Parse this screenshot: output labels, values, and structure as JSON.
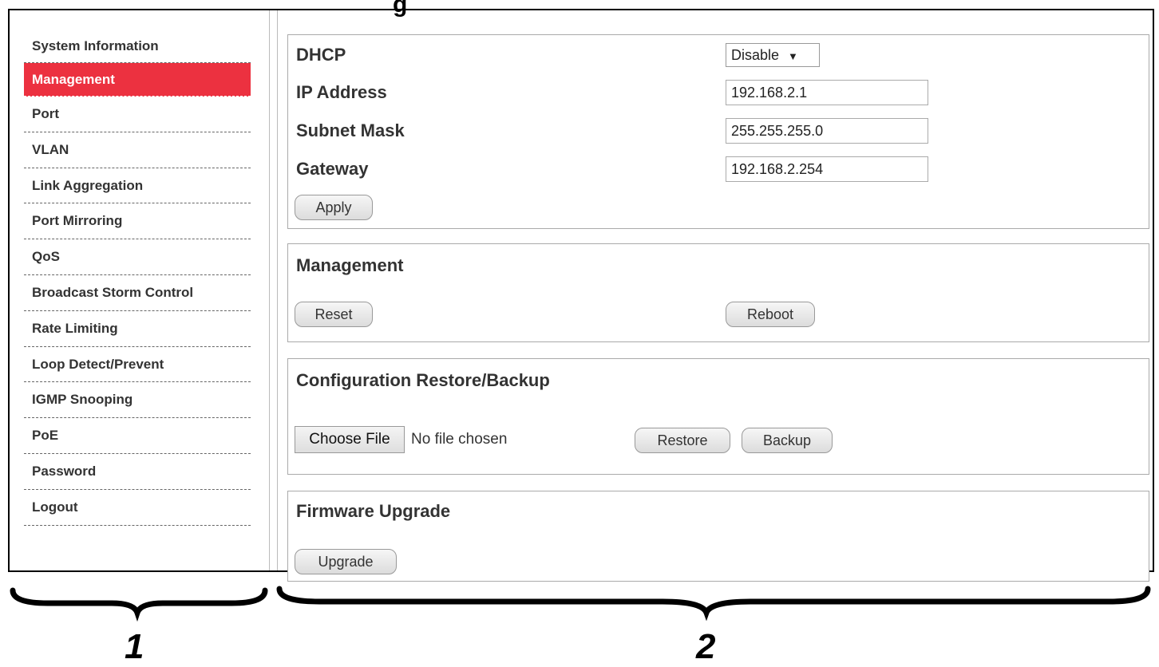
{
  "page_title_partial": "g",
  "sidebar": {
    "items": [
      {
        "label": "System Information",
        "active": false
      },
      {
        "label": "Management",
        "active": true
      },
      {
        "label": "Port",
        "active": false
      },
      {
        "label": "VLAN",
        "active": false
      },
      {
        "label": "Link Aggregation",
        "active": false
      },
      {
        "label": "Port Mirroring",
        "active": false
      },
      {
        "label": "QoS",
        "active": false
      },
      {
        "label": "Broadcast Storm Control",
        "active": false
      },
      {
        "label": "Rate Limiting",
        "active": false
      },
      {
        "label": "Loop Detect/Prevent",
        "active": false
      },
      {
        "label": "IGMP Snooping",
        "active": false
      },
      {
        "label": "PoE",
        "active": false
      },
      {
        "label": "Password",
        "active": false
      },
      {
        "label": "Logout",
        "active": false
      }
    ],
    "active_color": "#ec3140"
  },
  "ip_settings": {
    "dhcp_label": "DHCP",
    "dhcp_value": "Disable",
    "dhcp_arrow": "▼",
    "ip_label": "IP Address",
    "ip_value": "192.168.2.1",
    "subnet_label": "Subnet Mask",
    "subnet_value": "255.255.255.0",
    "gateway_label": "Gateway",
    "gateway_value": "192.168.2.254",
    "apply_label": "Apply"
  },
  "management": {
    "title": "Management",
    "reset_label": "Reset",
    "reboot_label": "Reboot"
  },
  "config": {
    "title": "Configuration Restore/Backup",
    "choose_file_label": "Choose File",
    "no_file_text": "No file chosen",
    "restore_label": "Restore",
    "backup_label": "Backup"
  },
  "firmware": {
    "title": "Firmware Upgrade",
    "upgrade_label": "Upgrade"
  },
  "annotations": {
    "left_number": "1",
    "right_number": "2"
  }
}
